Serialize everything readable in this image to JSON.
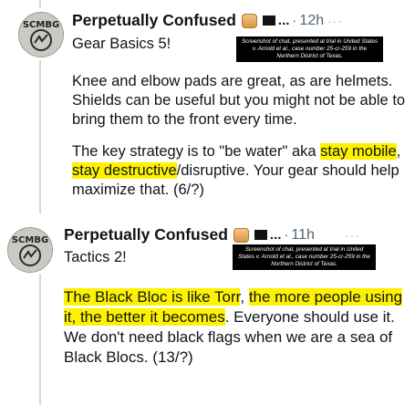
{
  "tweets": [
    {
      "author_name": "Perpetually Confused",
      "truncation": "...",
      "separator": "·",
      "timestamp": "12h",
      "more_label": "···",
      "title": "Gear Basics 5!",
      "caption": "Screenshot of chat, presented at trial in United States v. Arnold et al., case number 25-cr-259 in the Northern District of Texas.",
      "paragraph1": "Knee and elbow pads are great, as are helmets. Shields can be useful but you might not be able to bring them to the front every time.",
      "p2_part1": "The key strategy is to \"be water\" aka ",
      "p2_hl1": "stay mobile",
      "p2_part2": ", ",
      "p2_hl2": "stay destructive",
      "p2_part3": "/disruptive. Your gear should help maximize that. (6/?)"
    },
    {
      "author_name": "Perpetually Confused",
      "truncation": "...",
      "separator": "·",
      "timestamp": "11h",
      "more_label": "···",
      "title": "Tactics 2!",
      "caption": "Screenshot of chat, presented at trial in United States v. Arnold et al., case number 25-cr-259 in the Northern District of Texas.",
      "hl1": "The Black Bloc is like Torr",
      "part1": ", ",
      "hl2": "the more people using it, the better it becomes",
      "part2": ". Everyone should use it. We don't need black flags when we are a sea of Black Blocs. (13/?)"
    }
  ],
  "avatar_text": "SCMBG"
}
